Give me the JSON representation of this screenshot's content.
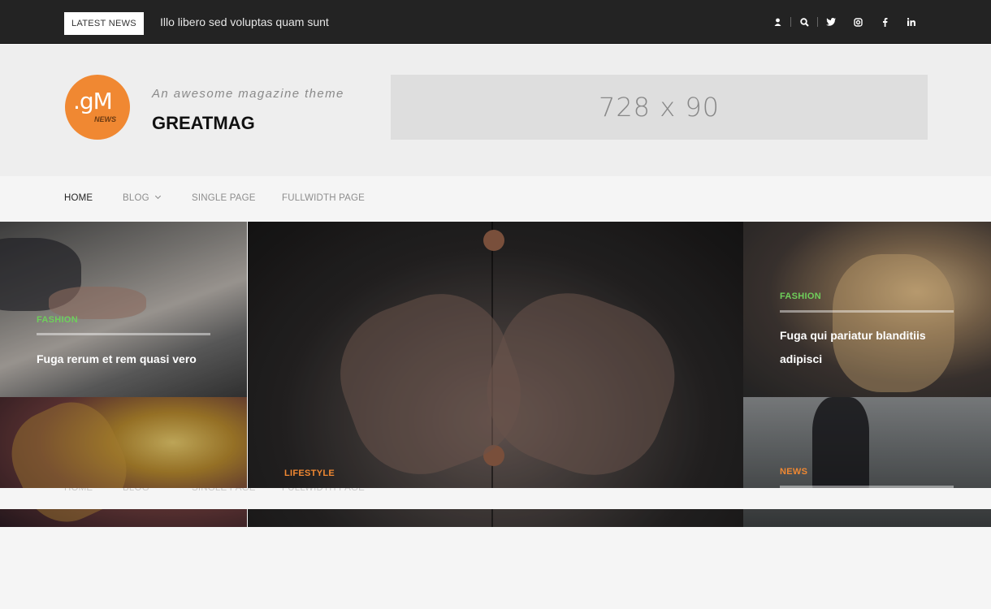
{
  "topbar": {
    "latest_label": "LATEST NEWS",
    "latest_headline": "Illo libero sed voluptas quam sunt",
    "social_icons": [
      "user-icon",
      "search-icon",
      "twitter-icon",
      "instagram-icon",
      "facebook-icon",
      "linkedin-icon"
    ]
  },
  "header": {
    "logo_text": ".gM",
    "logo_sub": "NEWS",
    "tagline": "An awesome magazine theme",
    "site_title": "GREATMAG",
    "ad_text": "728 x 90",
    "accent_color": "#f08832"
  },
  "nav": {
    "items": [
      {
        "label": "HOME"
      },
      {
        "label": "BLOG"
      },
      {
        "label": "SINGLE PAGE"
      },
      {
        "label": "FULLWIDTH PAGE"
      }
    ]
  },
  "featured": [
    {
      "category": "FASHION",
      "title": "Fuga rerum et rem quasi vero",
      "category_color": "#6fcf5b"
    },
    {
      "category": "LIFESTYLE",
      "title": "",
      "category_color": "#f08832"
    },
    {
      "category": "FASHION",
      "title_line1": "Fuga qui pariatur blanditiis",
      "title_line2": "adipisci",
      "category_color": "#6fcf5b"
    },
    {
      "category": "NEWS",
      "title": "",
      "category_color": "#f08832"
    }
  ]
}
